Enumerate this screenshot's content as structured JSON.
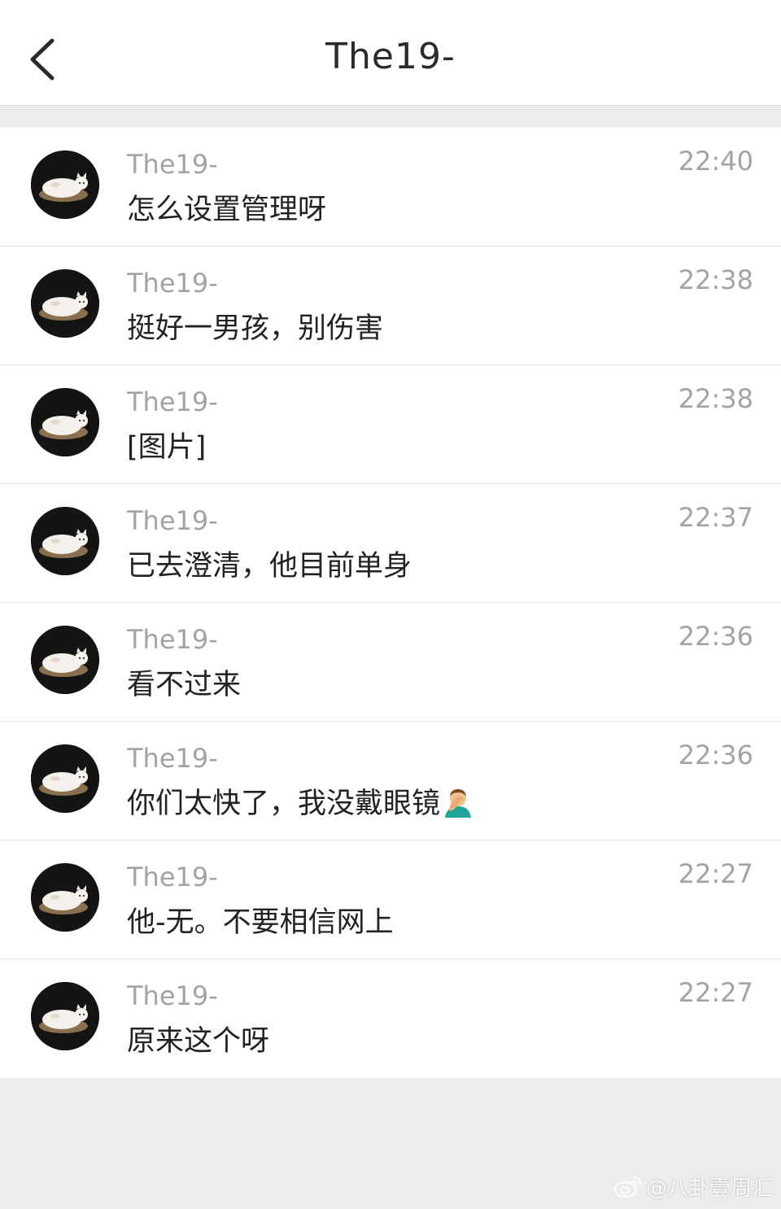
{
  "header": {
    "title": "The19-",
    "back_icon": "chevron-left-icon"
  },
  "messages": [
    {
      "sender": "The19-",
      "text": "怎么设置管理呀",
      "time": "22:40"
    },
    {
      "sender": "The19-",
      "text": "挺好一男孩，别伤害",
      "time": "22:38"
    },
    {
      "sender": "The19-",
      "text": "[图片]",
      "time": "22:38"
    },
    {
      "sender": "The19-",
      "text": "已去澄清，他目前单身",
      "time": "22:37"
    },
    {
      "sender": "The19-",
      "text": "看不过来",
      "time": "22:36"
    },
    {
      "sender": "The19-",
      "text": "你们太快了，我没戴眼镜",
      "time": "22:36",
      "emoji": "facepalm-emoji"
    },
    {
      "sender": "The19-",
      "text": "他-无。不要相信网上",
      "time": "22:27"
    },
    {
      "sender": "The19-",
      "text": "原来这个呀",
      "time": "22:27"
    }
  ],
  "watermark": {
    "text": "@八卦壹周汇",
    "icon": "weibo-logo-icon"
  },
  "colors": {
    "background": "#ececec",
    "row_background": "#ffffff",
    "secondary_text": "#a3a3a3",
    "primary_text": "#222222"
  }
}
